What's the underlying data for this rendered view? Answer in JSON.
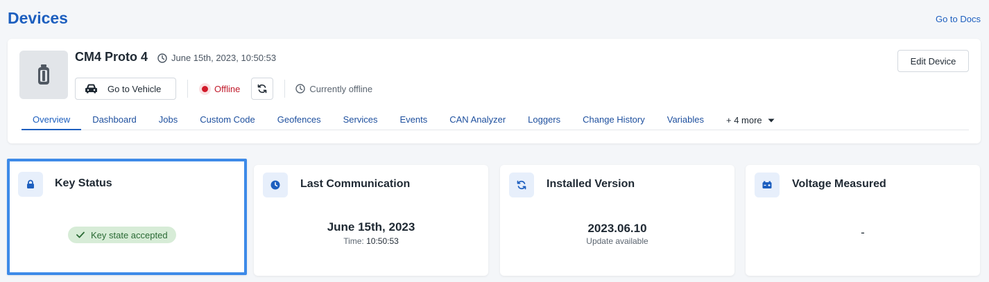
{
  "header": {
    "title": "Devices",
    "docs_link": "Go to Docs"
  },
  "device": {
    "name": "CM4 Proto 4",
    "timestamp": "June 15th, 2023, 10:50:53",
    "go_to_vehicle": "Go to Vehicle",
    "status": "Offline",
    "status_color": "#d11a2a",
    "offline_note": "Currently offline",
    "edit_label": "Edit Device"
  },
  "tabs": [
    {
      "label": "Overview",
      "active": true
    },
    {
      "label": "Dashboard"
    },
    {
      "label": "Jobs"
    },
    {
      "label": "Custom Code"
    },
    {
      "label": "Geofences"
    },
    {
      "label": "Services"
    },
    {
      "label": "Events"
    },
    {
      "label": "CAN Analyzer"
    },
    {
      "label": "Loggers"
    },
    {
      "label": "Change History"
    },
    {
      "label": "Variables"
    }
  ],
  "tabs_more": "+ 4 more",
  "cards": {
    "key_status": {
      "title": "Key Status",
      "icon": "lock-icon",
      "badge": "Key state accepted"
    },
    "last_communication": {
      "title": "Last Communication",
      "icon": "clock-icon",
      "date": "June 15th, 2023",
      "time_label": "Time:",
      "time_value": "10:50:53"
    },
    "installed_version": {
      "title": "Installed Version",
      "icon": "sync-icon",
      "version": "2023.06.10",
      "note": "Update available"
    },
    "voltage": {
      "title": "Voltage Measured",
      "icon": "battery-icon",
      "value": "-"
    }
  },
  "colors": {
    "accent": "#1d5fbf",
    "highlight_border": "#3d8ae8",
    "badge_bg": "#d7ecd7",
    "badge_text": "#2a6a34"
  }
}
